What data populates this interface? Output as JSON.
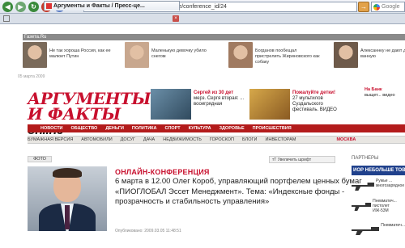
{
  "browser": {
    "url": "http://aif.ru/conference/conference/conference_id/24",
    "go_label": "→",
    "search_placeholder": "Google",
    "tab_title": "Аргументы и Факты / Пресс-це...",
    "icons": [
      "back-icon",
      "forward-icon",
      "reload-icon",
      "stop-icon",
      "home-icon",
      "favicon",
      "close-tab-icon",
      "google-icon"
    ]
  },
  "gazeta": {
    "label": "Газета.Ru",
    "date": "05 марта 2009",
    "news": [
      {
        "text": "Не так хороша Россия, как ее малюет Путин",
        "color": "#7a6a5a"
      },
      {
        "text": "Маленькую девочку убило снегом",
        "color": "#c8a78e"
      },
      {
        "text": "Богданов пообещал пристрелить Жириновского как собаку",
        "color": "#a07a60"
      },
      {
        "text": "Алексаннку не дают доступ в ванную",
        "color": "#6e5a4a"
      }
    ]
  },
  "aif": {
    "logo_line1": "АРГУМЕНТЫ",
    "logo_line2": "И ФАКТЫ",
    "logo_online": "online",
    "promo1": {
      "red": "Сергей из 30 дет",
      "rest": "мерз. Сергя вторая: ... вооигрядная"
    },
    "promo2": {
      "red": "Пожалуйте детки!",
      "rest": "27 мультилов Суздальского фестиваль. ВИДЕО"
    },
    "promo3": {
      "red": "На Банк",
      "rest": "выщет... видео"
    }
  },
  "nav_main": [
    "НОВОСТИ",
    "ОБЩЕСТВО",
    "ДЕНЬГИ",
    "ПОЛИТИКА",
    "СПОРТ",
    "КУЛЬТУРА",
    "ЗДОРОВЬЕ",
    "ПРОИСШЕСТВИЯ"
  ],
  "nav_sub": [
    "БУМАЖНАЯ ВЕРСИЯ",
    "АВТОМОБИЛИ",
    "ДОСУГ",
    "ДАЧА",
    "НЕДВИЖИМОСТЬ",
    "ГОРОСКОП",
    "БЛОГИ",
    "ИНВЕСТОРАМ"
  ],
  "nav_region": "МОСКВА",
  "article": {
    "foto_label": "ФОТО",
    "enlarge_label": "Увеличить шрифт",
    "kicker": "ОНЛАЙН-КОНФЕРЕНЦИЯ",
    "headline": "6 марта в 12.00 Олег Короб, управляющий портфелем ценных бумаг «ПИОГЛОБАЛ Эссет Менеджмент». Тема: «Индексные фонды - прозрачность и стабильность управления»",
    "published": "Опубликовано: 2009.03.05 11:48:51"
  },
  "right": {
    "partners_label": "ПАРТНЕРЫ",
    "banner": "ИОР НЕБОЛЬШЕ ТОВАР",
    "products": [
      {
        "text": "Ружье ... многозарядное"
      },
      {
        "text": "Пневматич... пистолет ИЖ-53М"
      },
      {
        "text": "Пневматич..."
      }
    ]
  },
  "colors": {
    "aif_red": "#c8102e",
    "nav_red": "#b31b1b"
  }
}
